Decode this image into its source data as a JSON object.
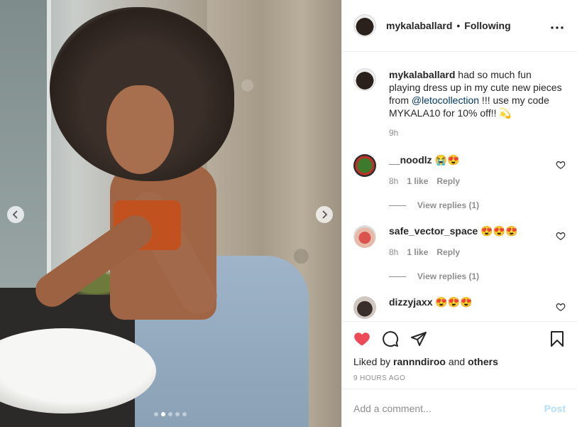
{
  "colors": {
    "like_red": "#ed4956",
    "link_blue": "#00376b",
    "post_disabled": "#b2dffc",
    "muted": "#8e8e8e"
  },
  "media": {
    "slide_count": 5,
    "active_slide": 2
  },
  "header": {
    "username": "mykalaballard",
    "separator": "•",
    "follow_status": "Following",
    "more_icon": "more-horizontal"
  },
  "caption": {
    "username": "mykalaballard",
    "text_before": " had so much fun playing dress up in my cute new pieces from ",
    "mention": "@letocollection",
    "text_after": " !!! use my code MYKALA10 for 10% off!! 💫",
    "time": "9h"
  },
  "comments": [
    {
      "username": "__noodlz",
      "text": "😭😍",
      "time": "8h",
      "likes": "1 like",
      "reply": "Reply",
      "view_replies": "View replies (1)"
    },
    {
      "username": "safe_vector_space",
      "text": "😍😍😍",
      "time": "8h",
      "likes": "1 like",
      "reply": "Reply",
      "view_replies": "View replies (1)"
    },
    {
      "username": "dizzyjaxx",
      "text": "😍😍😍"
    }
  ],
  "actions": {
    "liked_by_prefix": "Liked by ",
    "liked_by_user": "rannndiroo",
    "liked_by_and": " and ",
    "liked_by_others": "others",
    "posted_ago": "9 HOURS AGO"
  },
  "add_comment": {
    "placeholder": "Add a comment...",
    "post_label": "Post"
  }
}
